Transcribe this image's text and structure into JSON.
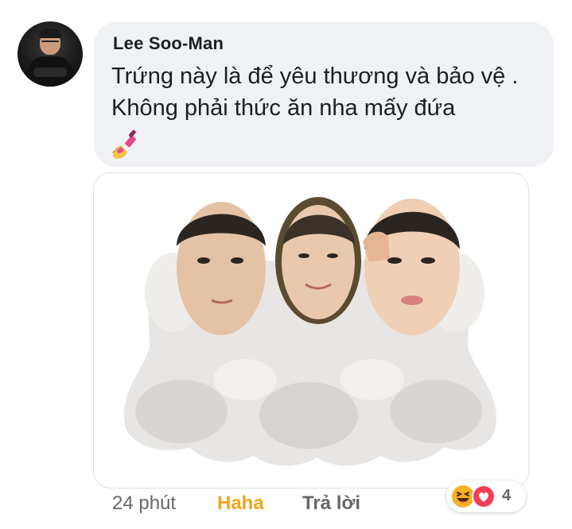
{
  "comment": {
    "author": "Lee Soo-Man",
    "text": "Trứng này là để yêu thương và bảo vệ . Không phải thức ăn nha mấy đứa",
    "emoji_icon": "nail-polish-icon"
  },
  "meta": {
    "time": "24 phút",
    "reaction_action": "Haha",
    "reply_label": "Trả lời"
  },
  "reactions": {
    "icons": [
      "haha-icon",
      "love-icon"
    ],
    "count": "4"
  },
  "colors": {
    "bubble_bg": "#eff1f4",
    "haha_text": "#f2a41e",
    "meta_text": "#65676b",
    "love_red": "#f33e58",
    "haha_yellow": "#f7b125"
  }
}
